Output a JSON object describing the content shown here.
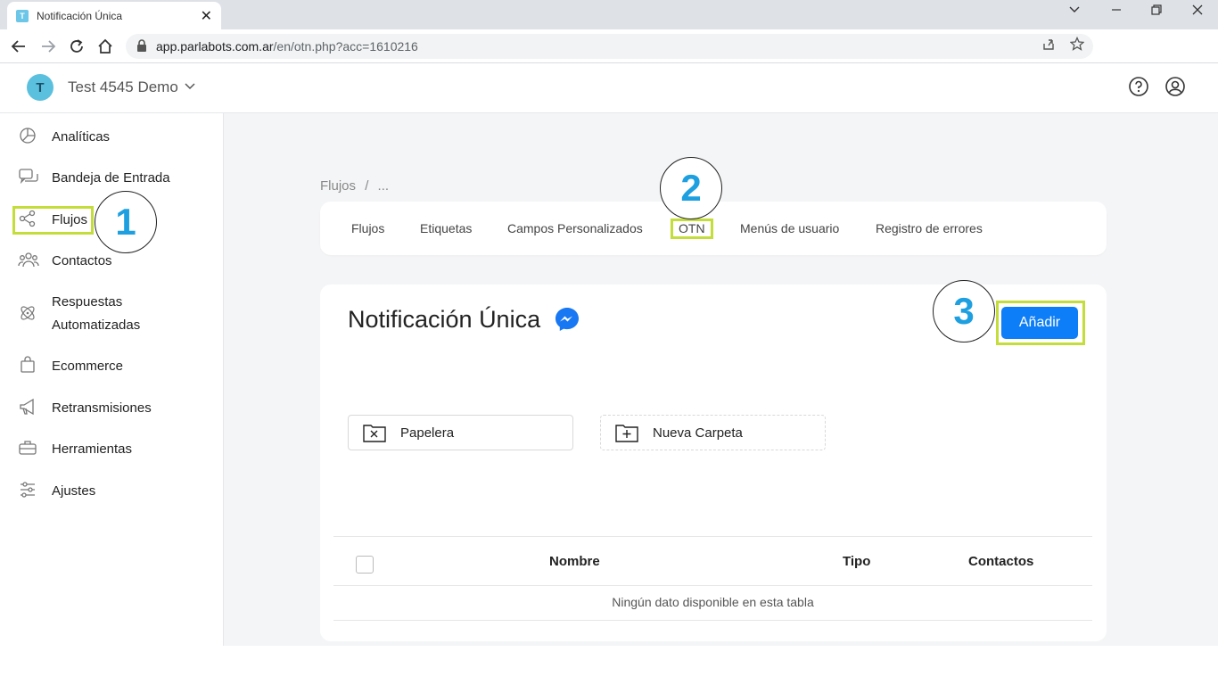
{
  "browser": {
    "tab_title": "Notificación Única",
    "tab_favicon_letter": "T",
    "url_domain": "app.parlabots.com.ar",
    "url_path": "/en/otn.php?acc=1610216"
  },
  "header": {
    "avatar_letter": "T",
    "workspace_name": "Test 4545 Demo"
  },
  "sidebar": {
    "items": [
      {
        "label": "Analíticas",
        "icon": "pie-chart-icon"
      },
      {
        "label": "Bandeja de Entrada",
        "icon": "chat-bubbles-icon"
      },
      {
        "label": "Flujos",
        "icon": "share-nodes-icon"
      },
      {
        "label": "Contactos",
        "icon": "users-icon"
      },
      {
        "label": "Respuestas",
        "label2": "Automatizadas",
        "icon": "atom-icon"
      },
      {
        "label": "Ecommerce",
        "icon": "shopping-bag-icon"
      },
      {
        "label": "Retransmisiones",
        "icon": "megaphone-icon"
      },
      {
        "label": "Herramientas",
        "icon": "toolbox-icon"
      },
      {
        "label": "Ajustes",
        "icon": "sliders-icon"
      }
    ]
  },
  "breadcrumb": {
    "root": "Flujos",
    "separator": "/",
    "current": "..."
  },
  "nav_tabs": [
    "Flujos",
    "Etiquetas",
    "Campos Personalizados",
    "OTN",
    "Menús de usuario",
    "Registro de errores"
  ],
  "main": {
    "title": "Notificación Única",
    "add_button": "Añadir",
    "folders": [
      {
        "label": "Papelera",
        "icon": "trash-folder-icon"
      },
      {
        "label": "Nueva Carpeta",
        "icon": "new-folder-icon"
      }
    ],
    "table": {
      "columns": [
        "Nombre",
        "Tipo",
        "Contactos"
      ],
      "empty_message": "Ningún dato disponible en esta tabla"
    }
  },
  "annotations": {
    "step1": "1",
    "step2": "2",
    "step3": "3"
  },
  "colors": {
    "accent_blue": "#0d7ef7",
    "highlight": "#c4dd3a",
    "step_number": "#1ea0e0",
    "avatar": "#5bc0de",
    "messenger": "#1877f2"
  }
}
